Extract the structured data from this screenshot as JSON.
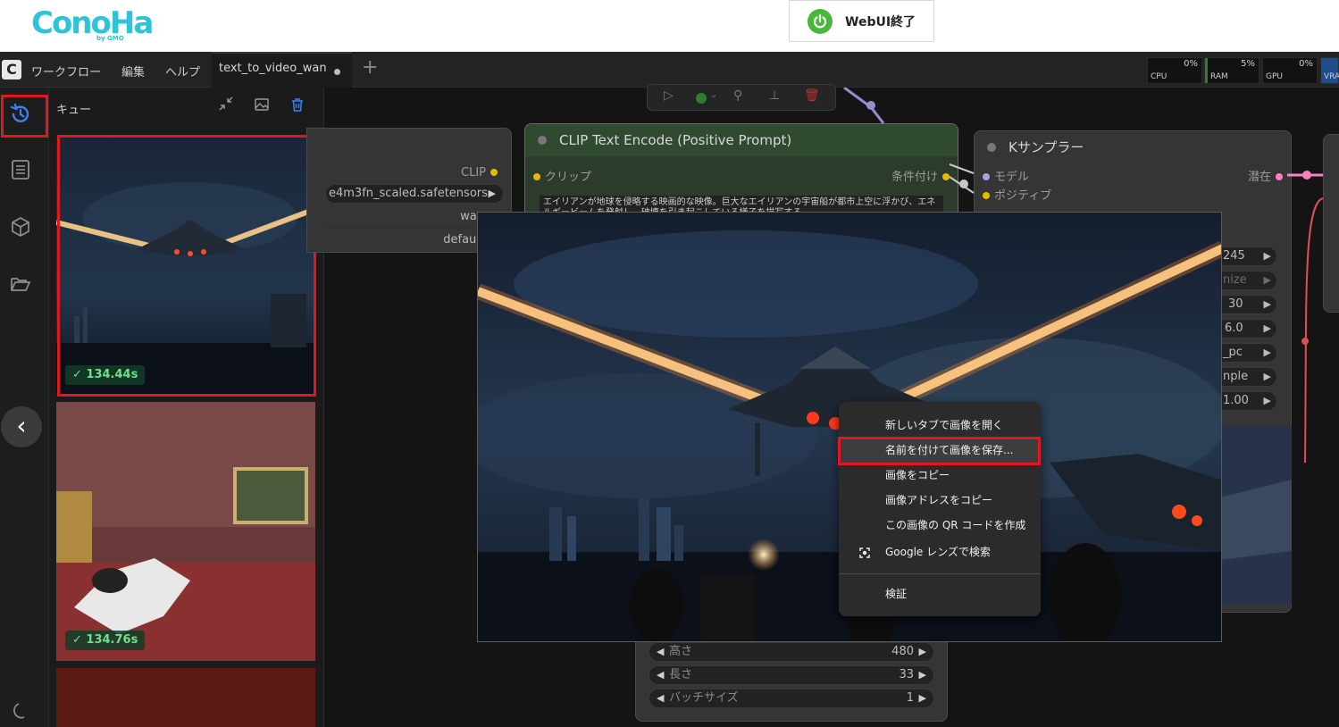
{
  "banner": {
    "logo_text": "ConoHa",
    "logo_sub": "by GMO",
    "webui_button": "WebUI終了"
  },
  "menubar": {
    "menus": [
      "ワークフロー",
      "編集",
      "ヘルプ"
    ],
    "tab_label": "text_to_video_wan",
    "monitors": [
      {
        "name": "CPU",
        "value": "0%"
      },
      {
        "name": "RAM",
        "value": "5%"
      },
      {
        "name": "GPU",
        "value": "0%"
      },
      {
        "name": "VRA",
        "value": ""
      }
    ]
  },
  "queue": {
    "title": "キュー",
    "items": [
      {
        "time": "134.44s"
      },
      {
        "time": "134.76s"
      }
    ]
  },
  "nodes": {
    "loader": {
      "output_label": "CLIP",
      "widgets": [
        "e4m3fn_scaled.safetensors",
        "wan",
        "default"
      ]
    },
    "clip_encode": {
      "title": "CLIP Text Encode (Positive Prompt)",
      "input_label": "クリップ",
      "output_label": "条件付け",
      "text": "エイリアンが地球を侵略する映画的な映像。巨大なエイリアンの宇宙船が都市上空に浮かび、エネルギービームを発射し、破壊を引き起こしている様子を描写する。"
    },
    "ksampler": {
      "title": "Kサンプラー",
      "inputs": [
        "モデル",
        "ポジティブ"
      ],
      "output_label": "潜在",
      "widget_values": [
        "245",
        "nize",
        "30",
        "6.0",
        "_pc",
        "nple",
        "1.00"
      ]
    },
    "latent": {
      "widgets": [
        {
          "label": "高さ",
          "value": "480"
        },
        {
          "label": "長さ",
          "value": "33"
        },
        {
          "label": "バッチサイズ",
          "value": "1"
        }
      ]
    }
  },
  "context_menu": {
    "items": [
      "新しいタブで画像を開く",
      "名前を付けて画像を保存...",
      "画像をコピー",
      "画像アドレスをコピー",
      "この画像の QR コードを作成",
      "Google レンズで検索",
      "検証"
    ]
  },
  "colors": {
    "accent_red": "#e0171f",
    "success_green": "#6fe08a",
    "clip_node_header": "#2f4a2f",
    "brand_cyan": "#2ec3d6"
  }
}
